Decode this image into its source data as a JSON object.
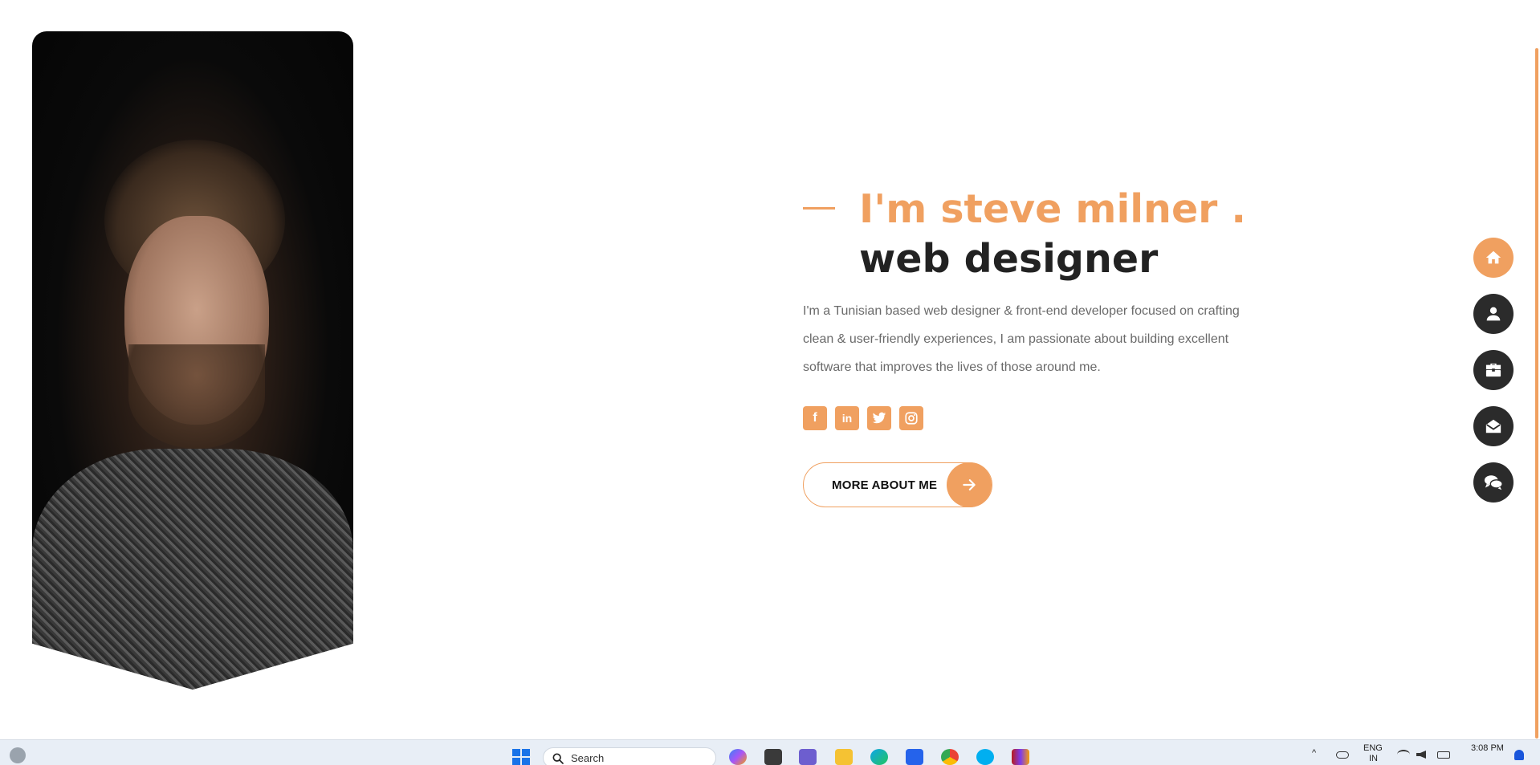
{
  "hero": {
    "name": "I'm steve milner .",
    "role": "web designer",
    "bio": "I'm a Tunisian based web designer & front-end developer focused on crafting clean & user-friendly experiences, I am passionate about building excellent software that improves the lives of those around me.",
    "button_label": "MORE ABOUT ME"
  },
  "socials": [
    {
      "icon": "facebook-icon",
      "glyph": "f"
    },
    {
      "icon": "linkedin-icon",
      "glyph": "in"
    },
    {
      "icon": "twitter-icon",
      "glyph": "t"
    },
    {
      "icon": "instagram-icon",
      "glyph": "◎"
    }
  ],
  "sidenav": [
    {
      "icon": "home-icon",
      "active": true
    },
    {
      "icon": "user-icon",
      "active": false
    },
    {
      "icon": "briefcase-icon",
      "active": false
    },
    {
      "icon": "envelope-open-icon",
      "active": false
    },
    {
      "icon": "comments-icon",
      "active": false
    }
  ],
  "taskbar": {
    "search_label": "Search",
    "language": "ENG",
    "region": "IN",
    "time": "3:08 PM"
  },
  "colors": {
    "accent": "#f0a060",
    "dark": "#2b2b2b",
    "text": "#6a6a6a"
  }
}
